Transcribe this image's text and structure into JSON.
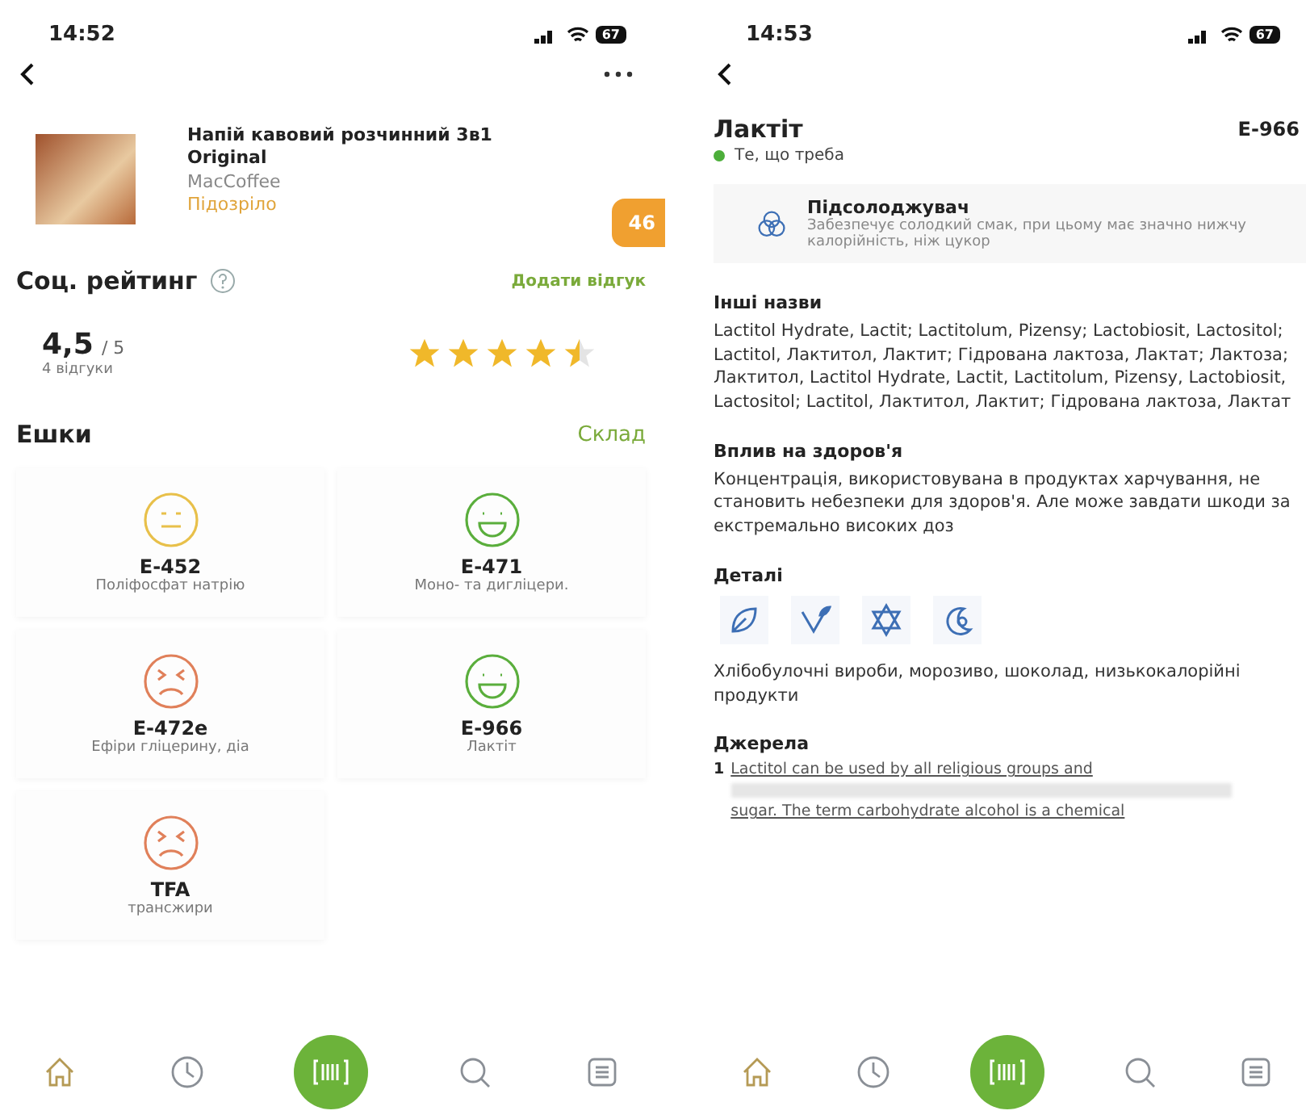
{
  "left_screen": {
    "status_bar": {
      "time": "14:52",
      "battery": "67"
    },
    "product": {
      "title": "Напій кавовий розчинний 3в1 Original",
      "brand": "MacCoffee",
      "category": "Підозріло",
      "score": "46"
    },
    "rating": {
      "heading": "Соц. рейтинг",
      "add_review": "Додати відгук",
      "score": "4,5",
      "max": "/ 5",
      "reviews": "4 відгуки",
      "stars": 4.5
    },
    "additives": {
      "heading": "Ешки",
      "link": "Склад",
      "items": [
        {
          "code": "E-452",
          "name": "Поліфосфат натрію",
          "kind": "neutral"
        },
        {
          "code": "E-471",
          "name": "Моно- та дигліцери.",
          "kind": "good"
        },
        {
          "code": "E-472e",
          "name": "Ефіри гліцерину, діа",
          "kind": "bad"
        },
        {
          "code": "E-966",
          "name": "Лактіт",
          "kind": "good"
        },
        {
          "code": "TFA",
          "name": "трансжири",
          "kind": "bad"
        }
      ]
    },
    "nav": [
      {
        "kind": "home",
        "selected": true
      },
      {
        "kind": "history",
        "selected": false
      },
      {
        "kind": "scan"
      },
      {
        "kind": "search",
        "selected": false
      },
      {
        "kind": "list",
        "selected": false
      }
    ]
  },
  "right_screen": {
    "status_bar": {
      "time": "14:53",
      "battery": "67"
    },
    "title": "Лактіт",
    "code": "E-966",
    "verdict": {
      "label": "Те, що треба",
      "color": "#4cae3a"
    },
    "function": {
      "name": "Підсолоджувач",
      "description": "Забезпечує солодкий смак, при цьому має значно нижчу калорійність, ніж цукор"
    },
    "other_names": {
      "heading": "Інші назви",
      "text": "Lactitol Hydrate, Lactit; Lactitolum, Pizensy; Lactobiosit, Lactositol; Lactitol, Лактитол, Лактит; Гідрована лактоза, Лактат; Лактоза; Лактитол, Lactitol Hydrate, Lactit, Lactitolum, Pizensy, Lactobiosit, Lactositol; Lactitol, Лактитол, Лактит; Гідрована лактоза, Лактат"
    },
    "health": {
      "heading": "Вплив на здоров'я",
      "text": "Концентрація, використовувана в продуктах харчування, не становить небезпеки для здоров'я. Але може завдати шкоди за екстремально високих доз"
    },
    "details": {
      "heading": "Деталі",
      "text": "Хлібобулочні вироби, морозиво, шоколад, низькокалорійні продукти"
    },
    "sources": {
      "heading": "Джерела",
      "number": "1",
      "lines": [
        "Lactitol can be used by all religious groups and",
        "sugar. The term carbohydrate alcohol is a chemical"
      ]
    },
    "nav": [
      {
        "kind": "home",
        "selected": true
      },
      {
        "kind": "history",
        "selected": false
      },
      {
        "kind": "scan"
      },
      {
        "kind": "search",
        "selected": false
      },
      {
        "kind": "list",
        "selected": false
      }
    ]
  }
}
